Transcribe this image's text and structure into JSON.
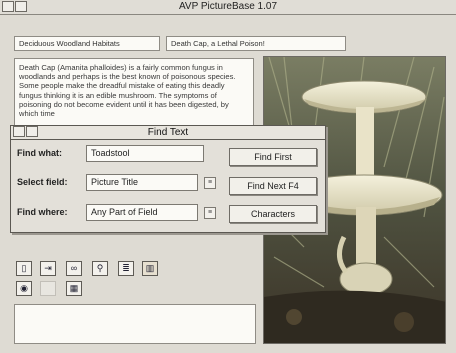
{
  "app": {
    "title": "AVP PictureBase 1.07"
  },
  "header_fields": {
    "habitat": "Deciduous Woodland Habitats",
    "caption": "Death Cap, a Lethal Poison!"
  },
  "description": "Death Cap (Amanita phalloides) is a fairly common fungus in woodlands and perhaps is the best known of poisonous species. Some people make the dreadful mistake of eating this deadly fungus thinking it is an edible mushroom. The symptoms of poisoning do not become evident until it has been digested, by which time",
  "find_dialog": {
    "title": "Find Text",
    "find_what_label": "Find what:",
    "find_what_value": "Toadstool",
    "select_field_label": "Select field:",
    "select_field_value": "Picture Title",
    "find_where_label": "Find where:",
    "find_where_value": "Any Part of Field",
    "find_first_label": "Find First",
    "find_next_label": "Find Next  F4",
    "characters_label": "Characters"
  },
  "toolbar": {
    "icons": [
      "record-icon",
      "record-next-icon",
      "binoculars-icon",
      "magnifier-icon",
      "disk-stack-icon",
      "chart-icon",
      "sound-icon",
      "blank-icon",
      "palette-icon"
    ]
  },
  "colors": {
    "window": "#dedbd3",
    "field": "#fbfaf6",
    "border": "#8f8c85"
  }
}
